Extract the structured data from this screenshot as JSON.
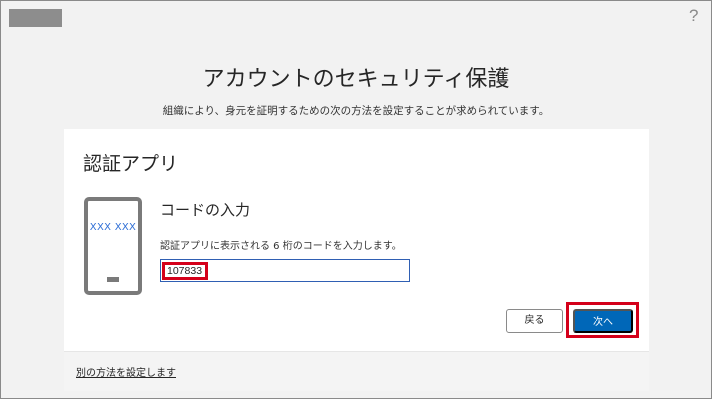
{
  "header": {
    "help_icon": "?"
  },
  "page": {
    "title": "アカウントのセキュリティ保護",
    "subtitle": "組織により、身元を証明するための次の方法を設定することが求められています。"
  },
  "card": {
    "title": "認証アプリ",
    "phone_placeholder": "XXX XXX",
    "section_heading": "コードの入力",
    "instruction": "認証アプリに表示される 6 桁のコードを入力します。",
    "code_value": "107833",
    "back_label": "戻る",
    "next_label": "次へ",
    "alt_method_link": "別の方法を設定します"
  },
  "colors": {
    "accent": "#0067b8",
    "highlight": "#d4001a",
    "phone_text": "#2f6fd6"
  }
}
